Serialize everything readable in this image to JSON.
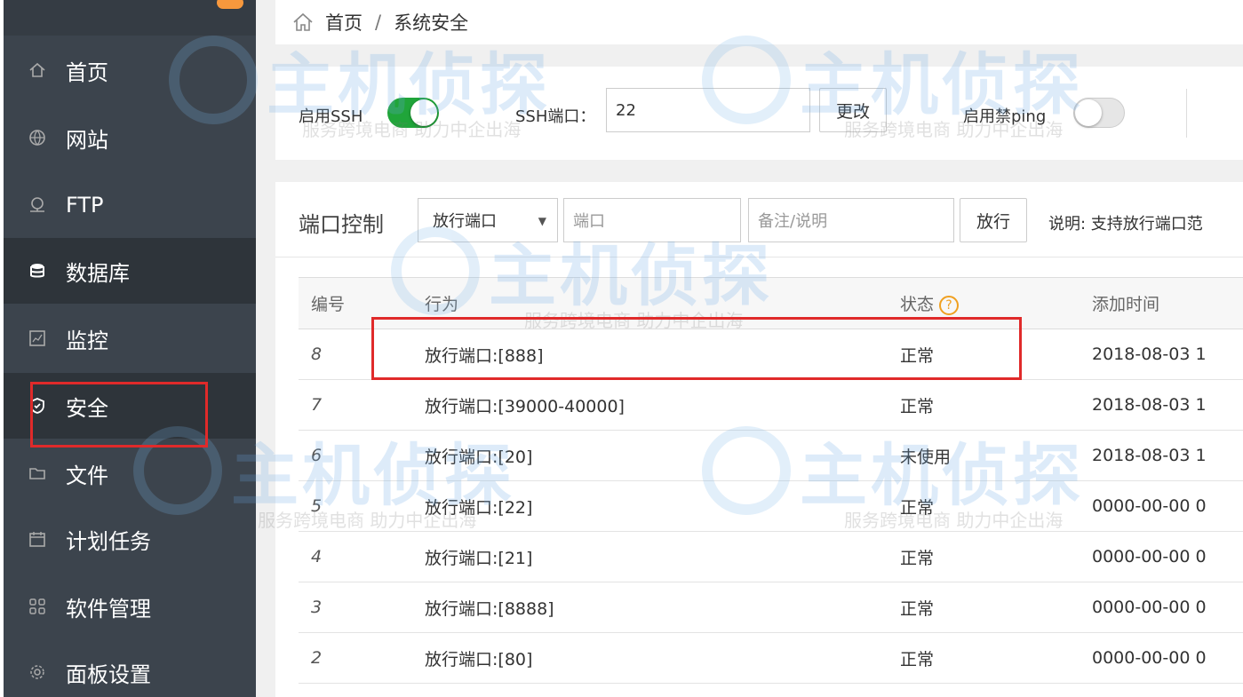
{
  "breadcrumb": {
    "home": "首页",
    "separator": "/",
    "current": "系统安全",
    "home_icon": "home-outline-icon"
  },
  "sidebar": {
    "items": [
      {
        "label": "首页",
        "icon": "home-icon",
        "active": false
      },
      {
        "label": "网站",
        "icon": "globe-icon",
        "active": false
      },
      {
        "label": "FTP",
        "icon": "ftp-icon",
        "active": false
      },
      {
        "label": "数据库",
        "icon": "database-icon",
        "active": true
      },
      {
        "label": "监控",
        "icon": "monitor-icon",
        "active": false
      },
      {
        "label": "安全",
        "icon": "shield-icon",
        "active": true
      },
      {
        "label": "文件",
        "icon": "folder-icon",
        "active": false
      },
      {
        "label": "计划任务",
        "icon": "calendar-icon",
        "active": false
      },
      {
        "label": "软件管理",
        "icon": "apps-grid-icon",
        "active": false
      },
      {
        "label": "面板设置",
        "icon": "gear-icon",
        "active": false
      }
    ]
  },
  "ssh": {
    "enable_label": "启用SSH",
    "enabled": true,
    "port_label": "SSH端口：",
    "port_value": "22",
    "change_button": "更改",
    "ping_label": "启用禁ping",
    "ping_enabled": false
  },
  "port_control": {
    "title": "端口控制",
    "select_value": "放行端口",
    "port_placeholder": "端口",
    "note_placeholder": "备注/说明",
    "allow_button": "放行",
    "description": "说明: 支持放行端口范"
  },
  "table": {
    "headers": {
      "id": "编号",
      "action": "行为",
      "status": "状态",
      "added": "添加时间"
    },
    "help_icon": "?",
    "rows": [
      {
        "id": "8",
        "action": "放行端口:[888]",
        "status": "正常",
        "added": "2018-08-03 1"
      },
      {
        "id": "7",
        "action": "放行端口:[39000-40000]",
        "status": "正常",
        "added": "2018-08-03 1"
      },
      {
        "id": "6",
        "action": "放行端口:[20]",
        "status": "未使用",
        "added": "2018-08-03 1"
      },
      {
        "id": "5",
        "action": "放行端口:[22]",
        "status": "正常",
        "added": "0000-00-00 0"
      },
      {
        "id": "4",
        "action": "放行端口:[21]",
        "status": "正常",
        "added": "0000-00-00 0"
      },
      {
        "id": "3",
        "action": "放行端口:[8888]",
        "status": "正常",
        "added": "0000-00-00 0"
      },
      {
        "id": "2",
        "action": "放行端口:[80]",
        "status": "正常",
        "added": "0000-00-00 0"
      }
    ]
  },
  "watermark": {
    "brand": "主机侦探",
    "tagline": "服务跨境电商 助力中企出海"
  },
  "colors": {
    "sidebar_bg": "#3c444d",
    "switch_on": "#20a53a",
    "highlight": "#e02a2a",
    "help_icon": "#f0a020"
  }
}
